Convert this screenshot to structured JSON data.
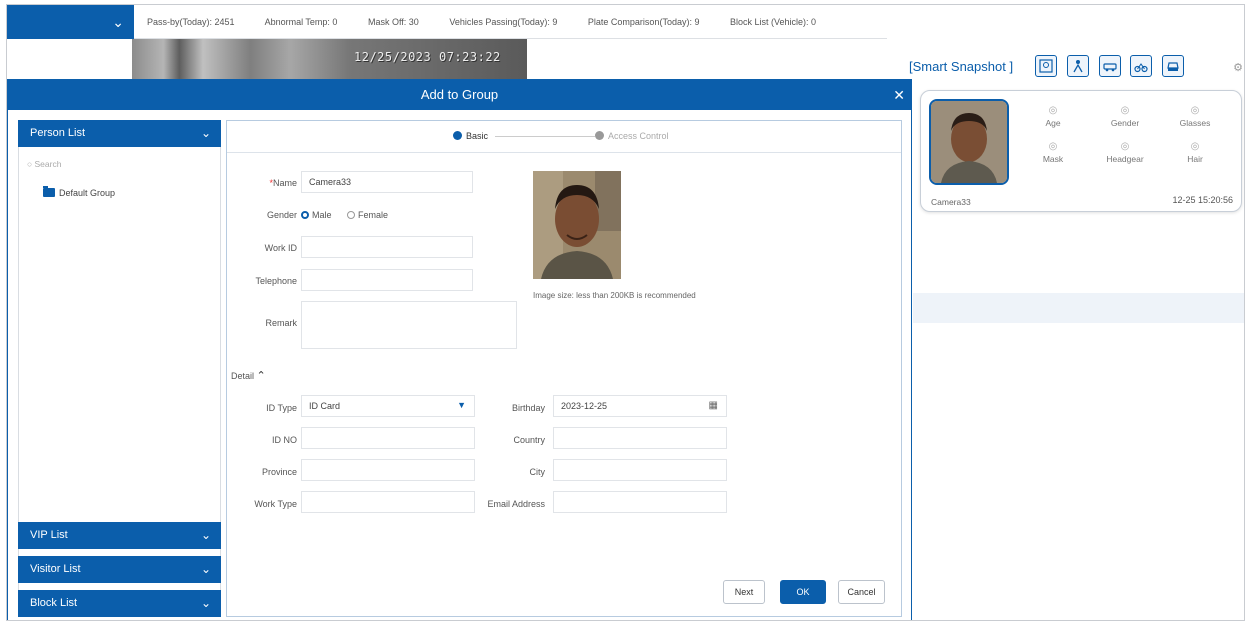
{
  "topbar": {
    "stats": [
      "Pass-by(Today): 2451",
      "Abnormal Temp: 0",
      "Mask Off: 30",
      "Vehicles Passing(Today): 9",
      "Plate Comparison(Today): 9",
      "Block List (Vehicle): 0"
    ]
  },
  "video": {
    "timestamp": "12/25/2023 07:23:22"
  },
  "snapshot": {
    "title": "[Smart Snapshot ]",
    "filter_icons": [
      "face-filter-icon",
      "human-body-icon",
      "motor-vehicle-icon",
      "non-motor-vehicle-icon",
      "vehicle-plate-icon"
    ],
    "card": {
      "attributes": [
        "Age",
        "Gender",
        "Glasses",
        "Mask",
        "Headgear",
        "Hair"
      ],
      "camera": "Camera33",
      "time": "12-25 15:20:56"
    }
  },
  "dialog": {
    "title": "Add to Group",
    "left": {
      "person_list": "Person List",
      "search_placeholder": "Search",
      "group": "Default Group",
      "vip_list": "VIP List",
      "visitor_list": "Visitor List",
      "block_list": "Block List"
    },
    "steps": {
      "basic": "Basic",
      "access": "Access Control"
    },
    "form": {
      "name_label": "Name",
      "name_value": "Camera33",
      "gender_label": "Gender",
      "male": "Male",
      "female": "Female",
      "workid_label": "Work ID",
      "telephone_label": "Telephone",
      "remark_label": "Remark",
      "image_hint": "Image size: less than 200KB is recommended",
      "detail_label": "Detail",
      "idtype_label": "ID Type",
      "idtype_value": "ID Card",
      "birthday_label": "Birthday",
      "birthday_value": "2023-12-25",
      "idno_label": "ID NO",
      "country_label": "Country",
      "province_label": "Province",
      "city_label": "City",
      "worktype_label": "Work Type",
      "email_label": "Email Address"
    },
    "buttons": {
      "next": "Next",
      "ok": "OK",
      "cancel": "Cancel"
    }
  },
  "colors": {
    "accent": "#0b5eab",
    "required": "#e33333"
  }
}
